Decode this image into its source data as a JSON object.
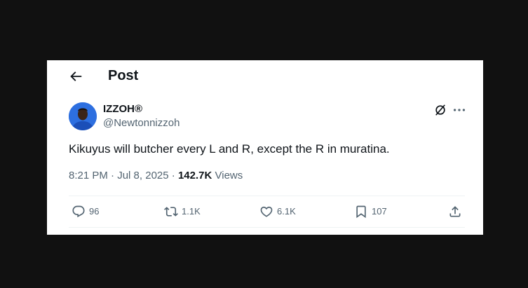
{
  "header": {
    "title": "Post"
  },
  "author": {
    "display_name": "IZZOH®",
    "handle": "@Newtonnizzoh"
  },
  "tweet": {
    "text": "Kikuyus will butcher every L and R, except the R in muratina.",
    "time": "8:21 PM",
    "separator": "·",
    "date": "Jul 8, 2025",
    "views_count": "142.7K",
    "views_label": "Views"
  },
  "actions": {
    "replies": "96",
    "reposts": "1.1K",
    "likes": "6.1K",
    "bookmarks": "107"
  },
  "colors": {
    "background": "#111111",
    "card": "#ffffff",
    "primary_text": "#0f1419",
    "secondary_text": "#536471",
    "avatar_accent": "#2d6fe0"
  }
}
